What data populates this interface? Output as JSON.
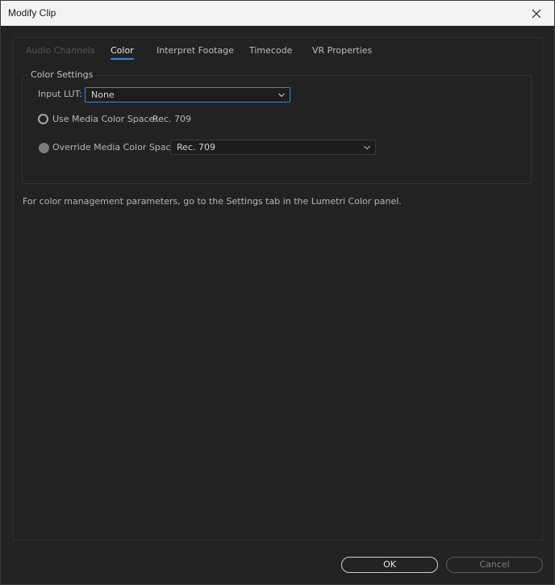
{
  "window": {
    "title": "Modify Clip"
  },
  "tabs": [
    {
      "label": "Audio Channels",
      "state": "disabled"
    },
    {
      "label": "Color",
      "state": "active"
    },
    {
      "label": "Interpret Footage",
      "state": "normal"
    },
    {
      "label": "Timecode",
      "state": "normal"
    },
    {
      "label": "VR Properties",
      "state": "normal"
    }
  ],
  "color_settings": {
    "legend": "Color Settings",
    "input_lut_label": "Input LUT:",
    "input_lut_value": "None",
    "use_media_label": "Use Media Color Space:",
    "use_media_value": "Rec. 709",
    "override_label": "Override Media Color Space:",
    "override_value": "Rec. 709"
  },
  "hint": "For color management parameters, go to the Settings tab in the Lumetri Color panel.",
  "buttons": {
    "ok": "OK",
    "cancel": "Cancel"
  },
  "colors": {
    "accent": "#2d8ceb",
    "background": "#232323",
    "titlebar": "#f3f3f3"
  }
}
